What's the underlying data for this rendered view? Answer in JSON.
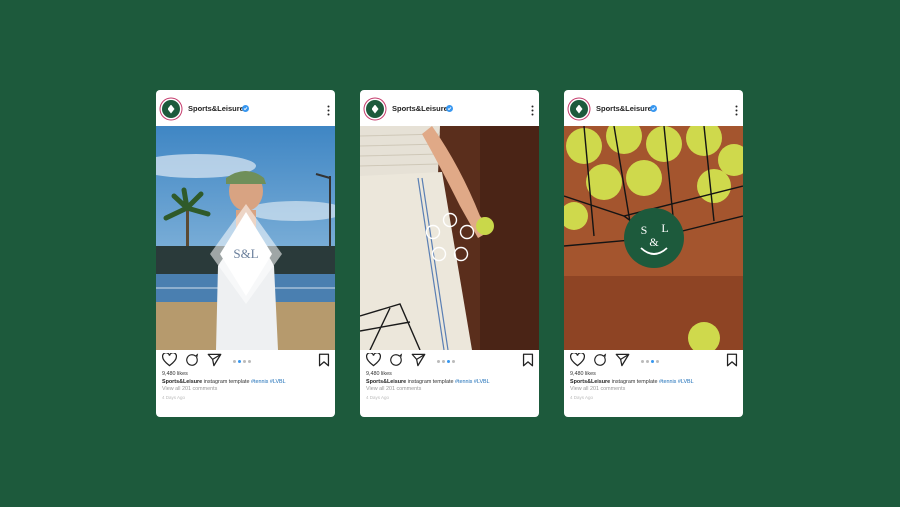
{
  "brand": "Sports&Leisure",
  "monogram": "S&L",
  "posts": [
    {
      "username": "Sports&Leisure",
      "likes": "9,480 likes",
      "caption_user": "Sports&Leisure",
      "caption_text": "instagram template",
      "hashtags": "#tennis #LVBL",
      "comments": "View all 201 comments",
      "time": "4 Days Ago",
      "carousel_index": 1
    },
    {
      "username": "Sports&Leisure",
      "likes": "9,480 likes",
      "caption_user": "Sports&Leisure",
      "caption_text": "instagram template",
      "hashtags": "#tennis #LVBL",
      "comments": "View all 201 comments",
      "time": "4 Days Ago",
      "carousel_index": 2
    },
    {
      "username": "Sports&Leisure",
      "likes": "9,480 likes",
      "caption_user": "Sports&Leisure",
      "caption_text": "instagram template",
      "hashtags": "#tennis #LVBL",
      "comments": "View all 201 comments",
      "time": "4 Days Ago",
      "carousel_index": 2
    }
  ],
  "colors": {
    "background": "#1d5a3c",
    "accent_blue": "#3897f0",
    "brand_green": "#1d5a3c"
  },
  "icons": [
    "heart-icon",
    "comment-icon",
    "share-icon",
    "bookmark-icon",
    "more-icon",
    "verified-icon"
  ]
}
